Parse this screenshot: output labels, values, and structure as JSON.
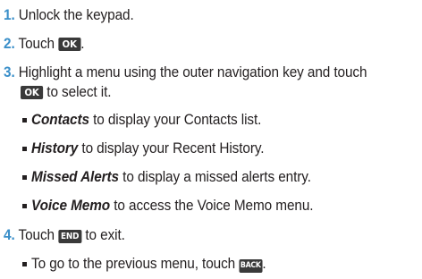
{
  "steps": [
    {
      "num": "1.",
      "text": "Unlock the keypad."
    },
    {
      "num": "2.",
      "pre": "Touch",
      "key": "OK",
      "post": "."
    },
    {
      "num": "3.",
      "line1": "Highlight a menu using the outer navigation key and touch",
      "key": "OK",
      "line2": "to select it."
    },
    {
      "num": "4.",
      "pre": "Touch",
      "key": "END",
      "post": "to exit."
    }
  ],
  "menu_items": [
    {
      "term": "Contacts",
      "desc": "to display your Contacts list."
    },
    {
      "term": "History",
      "desc": "to display your Recent History."
    },
    {
      "term": "Missed Alerts",
      "desc": "to display a missed alerts entry."
    },
    {
      "term": "Voice Memo",
      "desc": "to access the Voice Memo menu."
    }
  ],
  "note": {
    "text": "To go to the previous menu, touch",
    "key": "BACK",
    "post": "."
  },
  "colors": {
    "step_number": "#3a8fc9",
    "key_background": "#3a3a3a",
    "text": "#231f20"
  }
}
